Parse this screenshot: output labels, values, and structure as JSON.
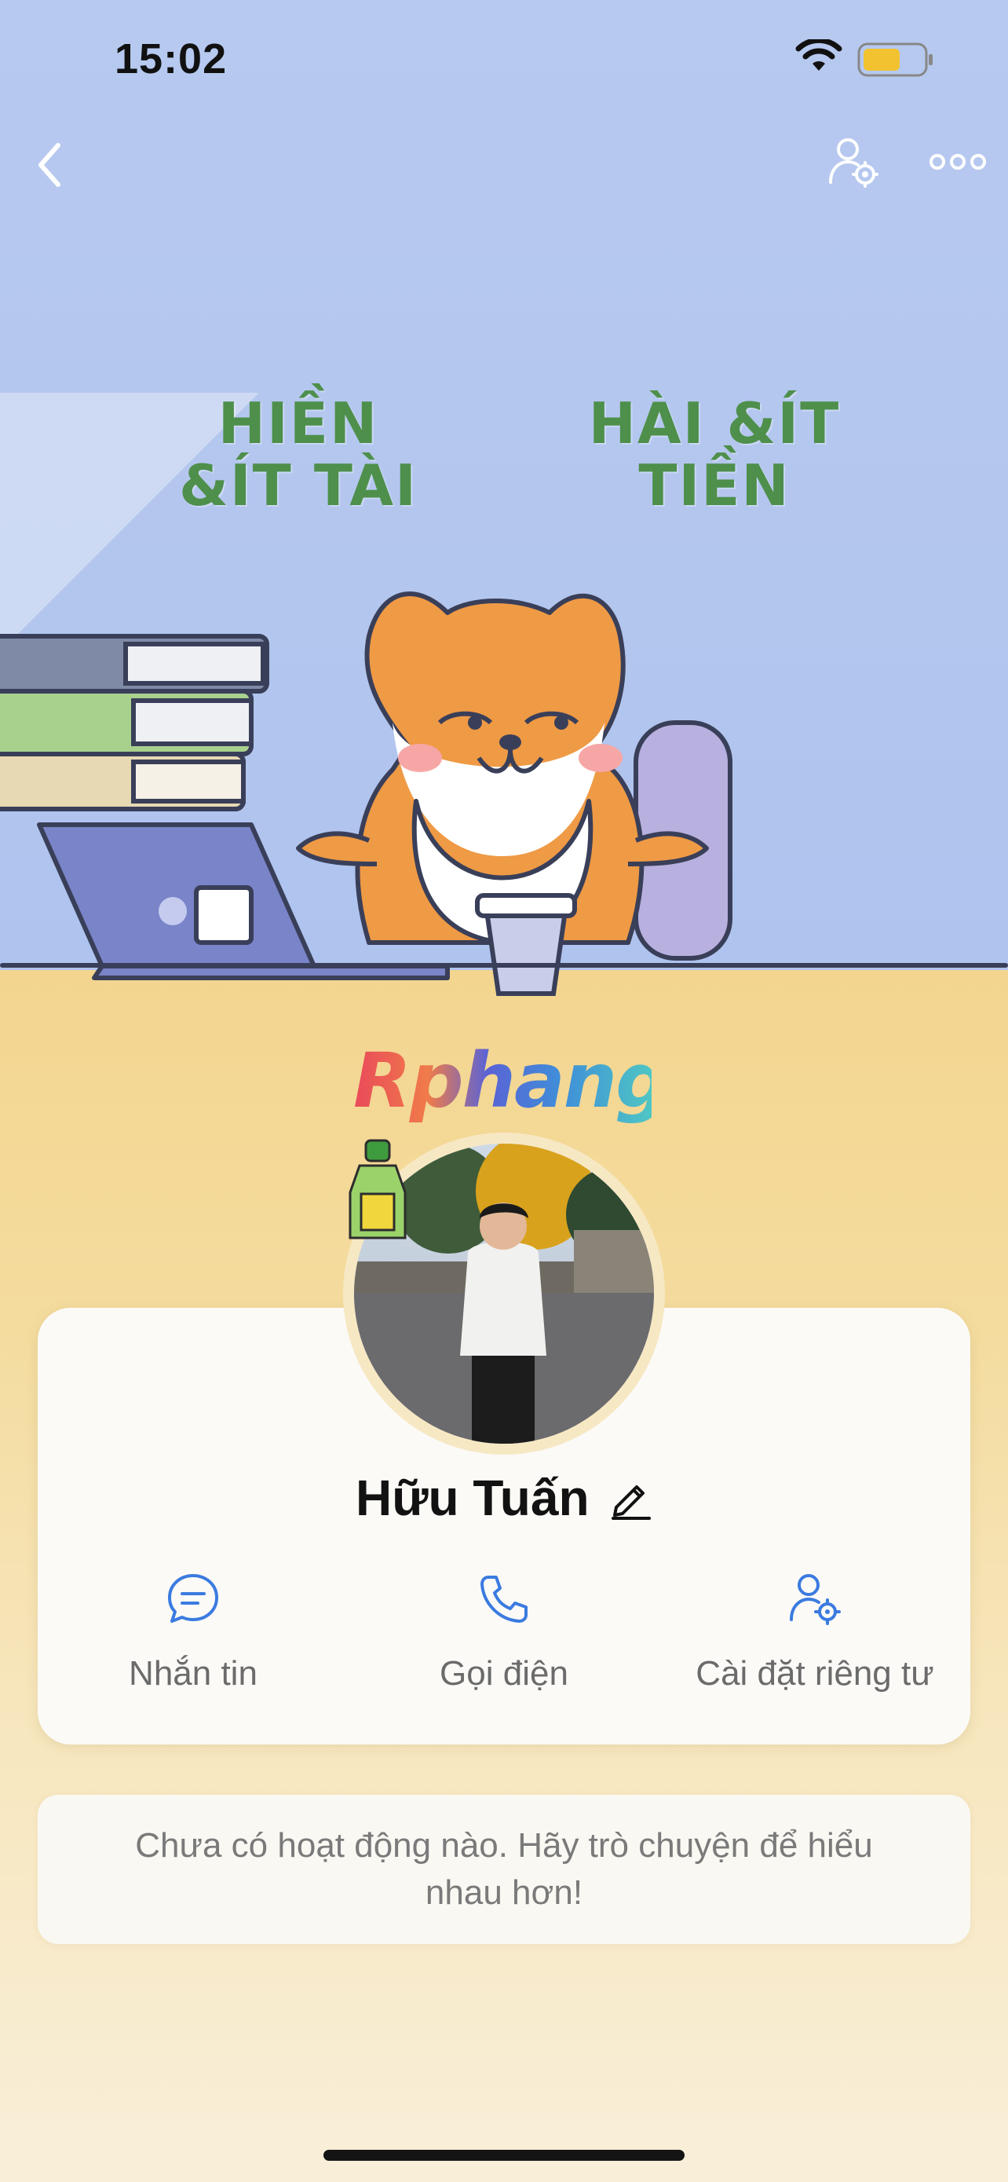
{
  "status_bar": {
    "time": "15:02"
  },
  "cover": {
    "left_text": "HIỀN &ÍT TÀI",
    "right_text": "HÀI &ÍT TIỀN"
  },
  "brand": {
    "logo_text": "Rphang"
  },
  "profile": {
    "name": "Hữu Tuấn"
  },
  "actions": [
    {
      "label": "Nhắn tin",
      "icon": "chat-icon"
    },
    {
      "label": "Gọi điện",
      "icon": "phone-icon"
    },
    {
      "label": "Cài đặt riêng tư",
      "icon": "privacy-settings-icon"
    }
  ],
  "activity": {
    "message": "Chưa có hoạt động nào. Hãy trò chuyện để hiểu nhau hơn!"
  },
  "colors": {
    "accent": "#3b7be0",
    "cover_bg": "#b5c8ef",
    "page_bg": "#f4dc9f",
    "text_muted": "#6b6b6b"
  }
}
